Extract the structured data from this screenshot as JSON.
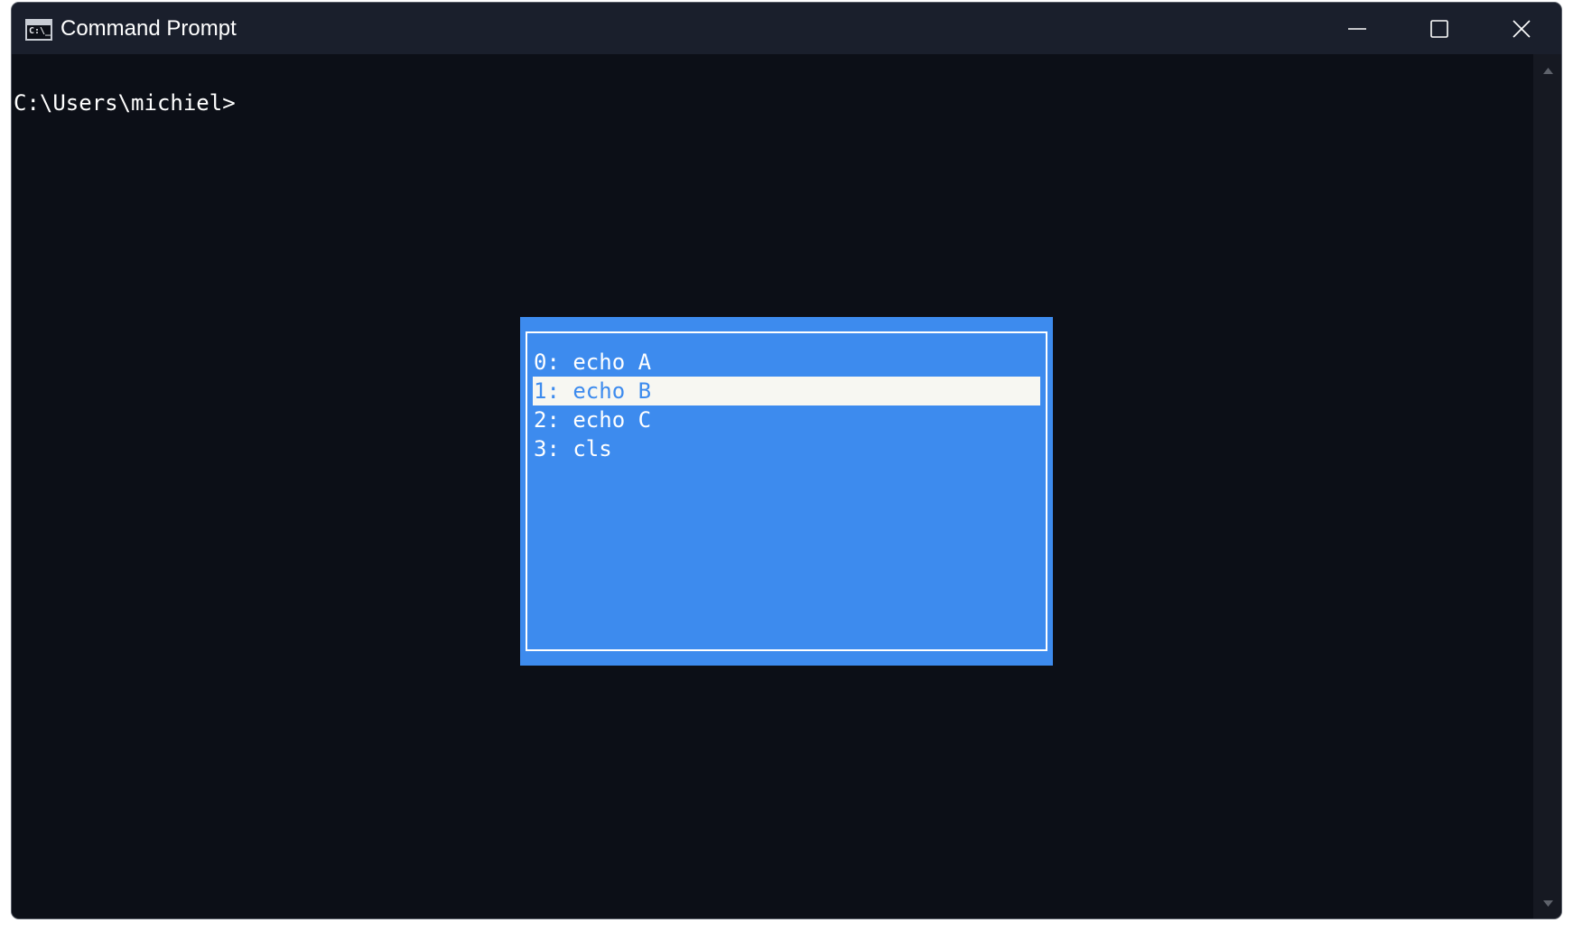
{
  "window": {
    "title": "Command Prompt",
    "icon": "cmd-icon",
    "icon_text": "C:\\_"
  },
  "console": {
    "prompt": "C:\\Users\\michiel>"
  },
  "history_popup": {
    "selected_index": 1,
    "items": [
      {
        "label": "0: echo A"
      },
      {
        "label": "1: echo B"
      },
      {
        "label": "2: echo C"
      },
      {
        "label": "3: cls"
      }
    ]
  },
  "colors": {
    "console_bg": "#0c0f17",
    "titlebar_bg": "#1a1f2c",
    "popup_bg": "#3d8bee",
    "selection_bg": "#f7f7f2"
  }
}
